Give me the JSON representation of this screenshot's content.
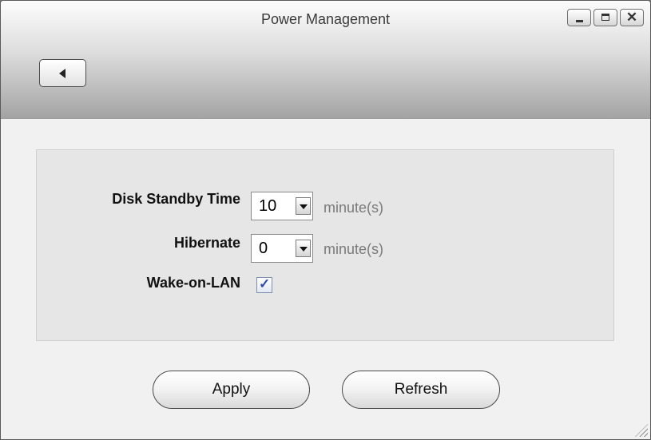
{
  "window": {
    "title": "Power Management",
    "controls": [
      "minimize",
      "maximize",
      "close"
    ],
    "close_glyph": "✕"
  },
  "toolbar": {
    "back_icon": "back-arrow-icon"
  },
  "form": {
    "disk_standby": {
      "label": "Disk Standby Time",
      "value": "10",
      "unit": "minute(s)"
    },
    "hibernate": {
      "label": "Hibernate",
      "value": "0",
      "unit": "minute(s)"
    },
    "wake_on_lan": {
      "label": "Wake-on-LAN",
      "checked": true,
      "check_glyph": "✓"
    }
  },
  "actions": {
    "apply_label": "Apply",
    "refresh_label": "Refresh"
  }
}
